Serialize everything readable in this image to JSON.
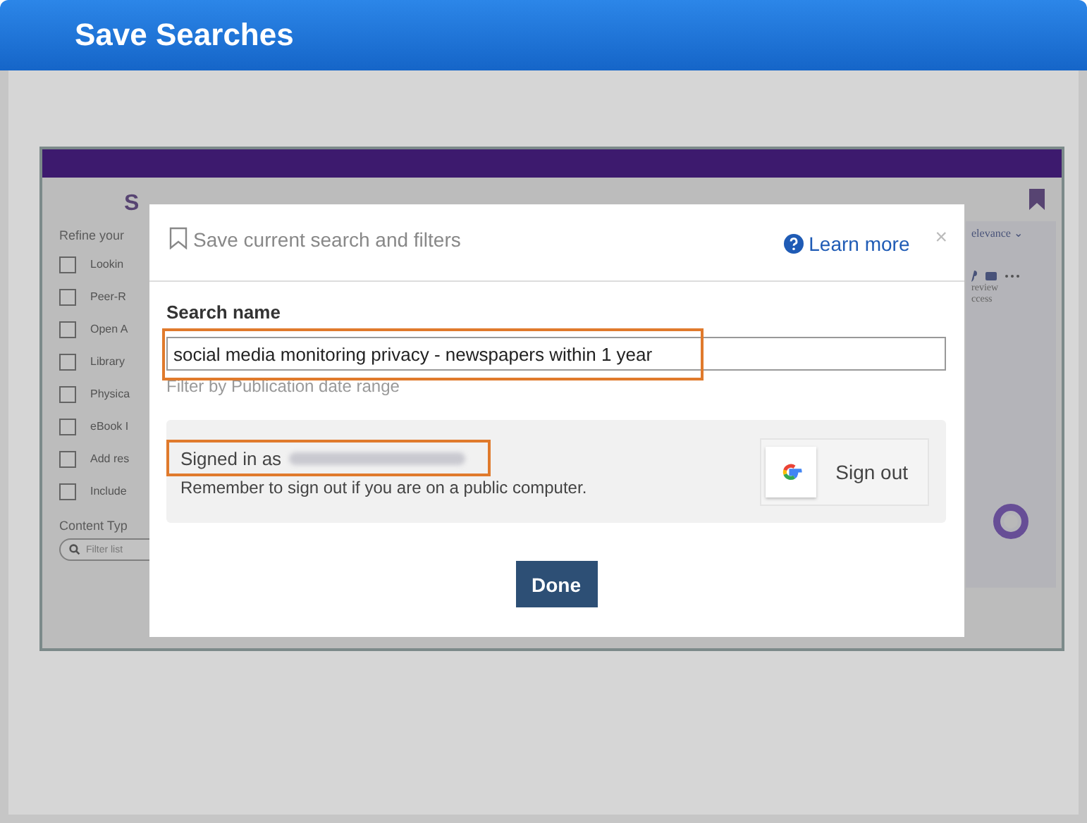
{
  "slide": {
    "title": "Save Searches"
  },
  "page": {
    "heading": "S",
    "refine_label": "Refine your",
    "filters": [
      {
        "label": "Lookin",
        "checked": false
      },
      {
        "label": "Peer-R",
        "checked": false
      },
      {
        "label": "Open A",
        "checked": false
      },
      {
        "label": "Library",
        "checked": false
      },
      {
        "label": "Physica",
        "checked": false
      },
      {
        "label": "eBook I",
        "checked": false
      },
      {
        "label": "Add res",
        "checked": false
      },
      {
        "label": "Include",
        "checked": false
      }
    ],
    "content_type_label": "Content Typ",
    "filter_placeholder": "Filter list",
    "sort": "elevance",
    "sort_caret": "⌄",
    "result_lines": [
      "review",
      "ccess"
    ]
  },
  "dialog": {
    "title": "Save current search and filters",
    "learn_more": "Learn more",
    "close": "×",
    "field_label": "Search name",
    "search_name": "social media monitoring privacy - newspapers within 1 year",
    "hint": "Filter by Publication date range",
    "signed_in": "Signed in as",
    "reminder": "Remember to sign out if you are on a public computer.",
    "sign_out": "Sign out",
    "done": "Done"
  }
}
